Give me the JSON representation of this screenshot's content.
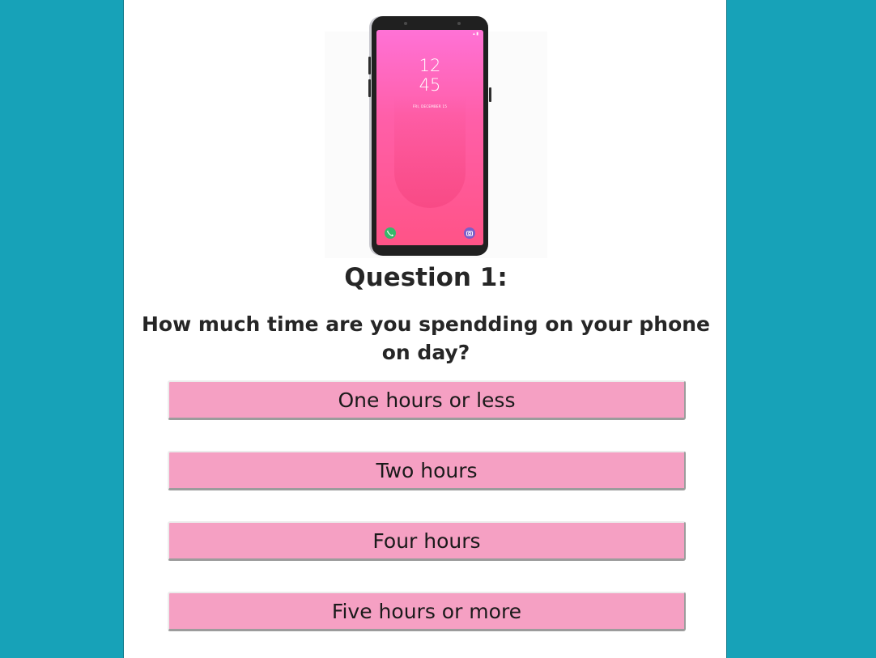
{
  "phone_image": {
    "clock_hours": "12",
    "clock_minutes": "45",
    "date": "FRI, DECEMBER 15",
    "icons": [
      "phone-icon",
      "camera-icon"
    ],
    "colors": {
      "screen_top": "#ff72d6",
      "screen_bottom": "#ff5387",
      "phone_icon": "#37b86b",
      "camera_icon": "#7a5fc9"
    }
  },
  "question": {
    "title": "Question 1:",
    "text": "How much time are you spendding on your phone on day?"
  },
  "answers": [
    {
      "label": "One hours or less"
    },
    {
      "label": "Two hours"
    },
    {
      "label": "Four hours"
    },
    {
      "label": "Five hours or more"
    }
  ],
  "colors": {
    "page_background": "#17a2b8",
    "card_background": "#ffffff",
    "answer_background": "#f5a0c3"
  }
}
